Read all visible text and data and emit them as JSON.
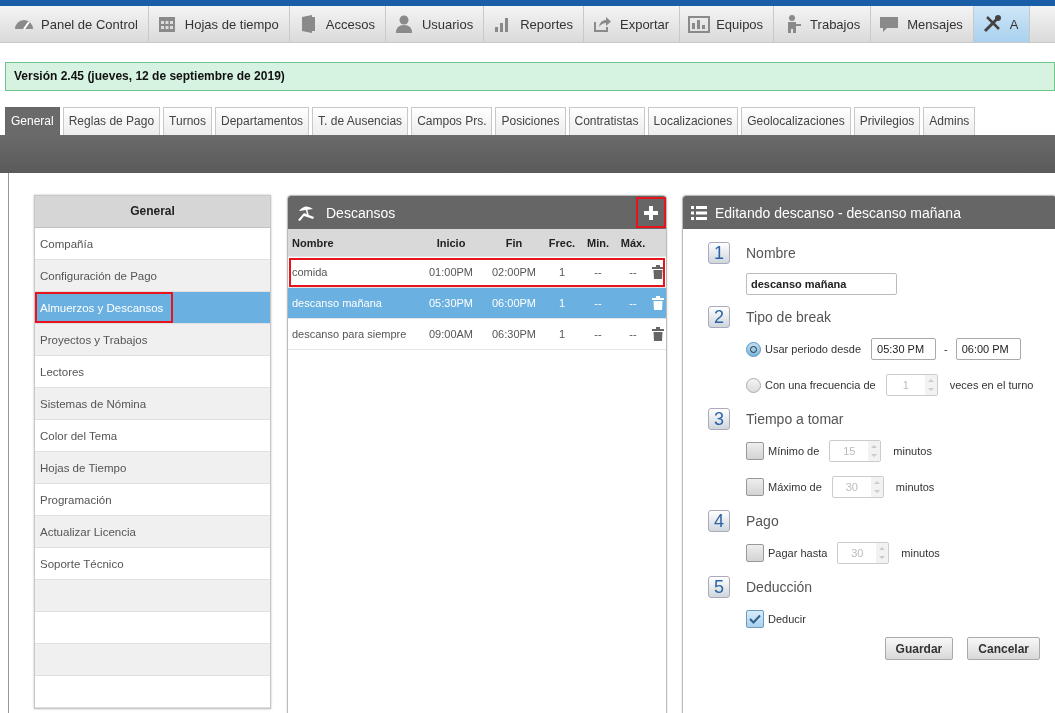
{
  "nav": [
    {
      "label": "Panel de Control",
      "selected": false
    },
    {
      "label": "Hojas de tiempo",
      "selected": false
    },
    {
      "label": "Accesos",
      "selected": false
    },
    {
      "label": "Usuarios",
      "selected": false
    },
    {
      "label": "Reportes",
      "selected": false
    },
    {
      "label": "Exportar",
      "selected": false
    },
    {
      "label": "Equipos",
      "selected": false
    },
    {
      "label": "Trabajos",
      "selected": false
    },
    {
      "label": "Mensajes",
      "selected": false
    },
    {
      "label": "A",
      "selected": true
    }
  ],
  "version": "Versión 2.45 (jueves, 12 de septiembre de 2019)",
  "tabs": [
    {
      "label": "General",
      "selected": true
    },
    {
      "label": "Reglas de Pago",
      "selected": false
    },
    {
      "label": "Turnos",
      "selected": false
    },
    {
      "label": "Departamentos",
      "selected": false
    },
    {
      "label": "T. de Ausencias",
      "selected": false
    },
    {
      "label": "Campos Prs.",
      "selected": false
    },
    {
      "label": "Posiciones",
      "selected": false
    },
    {
      "label": "Contratistas",
      "selected": false
    },
    {
      "label": "Localizaciones",
      "selected": false
    },
    {
      "label": "Geolocalizaciones",
      "selected": false
    },
    {
      "label": "Privilegios",
      "selected": false
    },
    {
      "label": "Admins",
      "selected": false
    }
  ],
  "sidebar": {
    "title": "General",
    "items": [
      {
        "label": "Compañía",
        "selected": false,
        "highlighted": false
      },
      {
        "label": "Configuración de Pago",
        "selected": false,
        "highlighted": false
      },
      {
        "label": "Almuerzos y Descansos",
        "selected": true,
        "highlighted": true
      },
      {
        "label": "Proyectos y Trabajos",
        "selected": false,
        "highlighted": false
      },
      {
        "label": "Lectores",
        "selected": false,
        "highlighted": false
      },
      {
        "label": "Sistemas de Nómina",
        "selected": false,
        "highlighted": false
      },
      {
        "label": "Color del Tema",
        "selected": false,
        "highlighted": false
      },
      {
        "label": "Hojas de Tiempo",
        "selected": false,
        "highlighted": false
      },
      {
        "label": "Programación",
        "selected": false,
        "highlighted": false
      },
      {
        "label": "Actualizar Licencia",
        "selected": false,
        "highlighted": false
      },
      {
        "label": "Soporte Técnico",
        "selected": false,
        "highlighted": false
      }
    ]
  },
  "breaks": {
    "title": "Descansos",
    "add_highlighted": true,
    "columns": [
      "Nombre",
      "Inicio",
      "Fin",
      "Frec.",
      "Min.",
      "Máx."
    ],
    "rows": [
      {
        "cells": [
          "comida",
          "01:00PM",
          "02:00PM",
          "1",
          "--",
          "--"
        ],
        "selected": false,
        "highlighted": true
      },
      {
        "cells": [
          "descanso mañana",
          "05:30PM",
          "06:00PM",
          "1",
          "--",
          "--"
        ],
        "selected": true,
        "highlighted": false
      },
      {
        "cells": [
          "descanso para siempre",
          "09:00AM",
          "06:30PM",
          "1",
          "--",
          "--"
        ],
        "selected": false,
        "highlighted": false
      }
    ]
  },
  "editor": {
    "title": "Editando descanso - descanso mañana",
    "sections": [
      {
        "number": "1",
        "title": "Nombre",
        "kind": "text",
        "value": "descanso mañana"
      },
      {
        "number": "2",
        "title": "Tipo de break",
        "kind": "options",
        "options": [
          {
            "kind": "radio",
            "label": "Usar periodo desde",
            "selected": true,
            "from": "05:30 PM",
            "separator": "-",
            "to": "06:00 PM"
          },
          {
            "kind": "radio",
            "label": "Con una frecuencia de",
            "selected": false,
            "value": "1",
            "suffix": "veces en el turno"
          }
        ]
      },
      {
        "number": "3",
        "title": "Tiempo a tomar",
        "kind": "options",
        "options": [
          {
            "kind": "check",
            "label": "Mínimo de",
            "checked": false,
            "value": "15",
            "suffix": "minutos"
          },
          {
            "kind": "check",
            "label": "Máximo de",
            "checked": false,
            "value": "30",
            "suffix": "minutos"
          }
        ]
      },
      {
        "number": "4",
        "title": "Pago",
        "kind": "options",
        "options": [
          {
            "kind": "check",
            "label": "Pagar hasta",
            "checked": false,
            "value": "30",
            "suffix": "minutos"
          }
        ]
      },
      {
        "number": "5",
        "title": "Deducción",
        "kind": "options",
        "options": [
          {
            "kind": "check",
            "label": "Deducir",
            "checked": true
          }
        ]
      }
    ],
    "buttons": [
      "Guardar",
      "Cancelar"
    ]
  }
}
